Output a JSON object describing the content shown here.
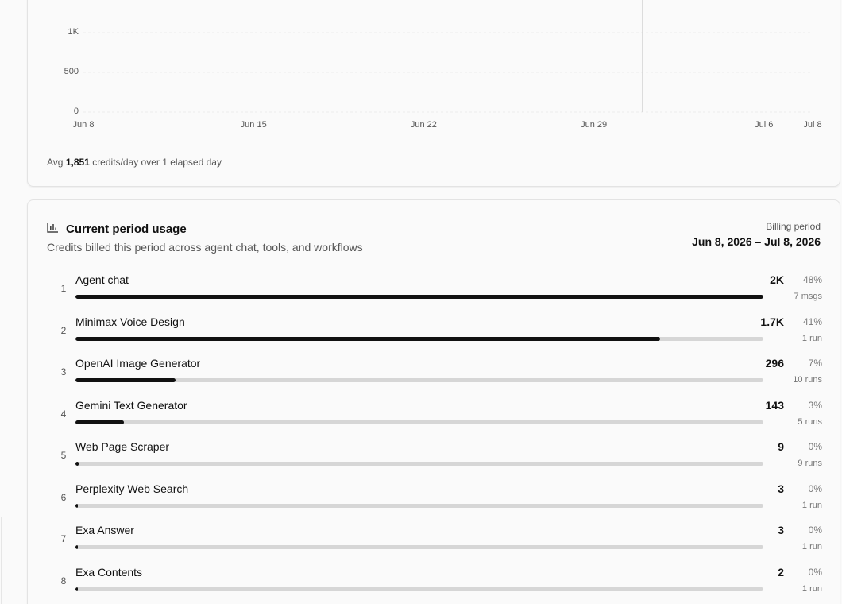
{
  "chart_data": {
    "type": "line",
    "y_ticks": [
      "1K",
      "500",
      "0"
    ],
    "ylim": [
      0,
      1000
    ],
    "x_ticks": [
      "Jun 8",
      "Jun 15",
      "Jun 22",
      "Jun 29",
      "Jul 6",
      "Jul 8"
    ],
    "grid": true,
    "today_marker": "Jul 1"
  },
  "summary": {
    "avg_prefix": "Avg",
    "avg_value": "1,851",
    "avg_suffix": "credits/day over 1 elapsed day"
  },
  "usage": {
    "title": "Current period usage",
    "subtitle": "Credits billed this period across agent chat, tools, and workflows",
    "billing_label": "Billing period",
    "billing_range": "Jun 8, 2026 – Jul 8, 2026",
    "icon": "bar-chart-icon",
    "bar_color": "#111111",
    "track_color": "#d6d6d6",
    "rows": [
      {
        "rank": "1",
        "name": "Agent chat",
        "value": "2K",
        "pct": "48%",
        "count": "7 msgs",
        "fill": 1.0
      },
      {
        "rank": "2",
        "name": "Minimax Voice Design",
        "value": "1.7K",
        "pct": "41%",
        "count": "1 run",
        "fill": 0.85
      },
      {
        "rank": "3",
        "name": "OpenAI Image Generator",
        "value": "296",
        "pct": "7%",
        "count": "10 runs",
        "fill": 0.146
      },
      {
        "rank": "4",
        "name": "Gemini Text Generator",
        "value": "143",
        "pct": "3%",
        "count": "5 runs",
        "fill": 0.071
      },
      {
        "rank": "5",
        "name": "Web Page Scraper",
        "value": "9",
        "pct": "0%",
        "count": "9 runs",
        "fill": 0.005
      },
      {
        "rank": "6",
        "name": "Perplexity Web Search",
        "value": "3",
        "pct": "0%",
        "count": "1 run",
        "fill": 0.002
      },
      {
        "rank": "7",
        "name": "Exa Answer",
        "value": "3",
        "pct": "0%",
        "count": "1 run",
        "fill": 0.002
      },
      {
        "rank": "8",
        "name": "Exa Contents",
        "value": "2",
        "pct": "0%",
        "count": "1 run",
        "fill": 0.001
      }
    ]
  }
}
